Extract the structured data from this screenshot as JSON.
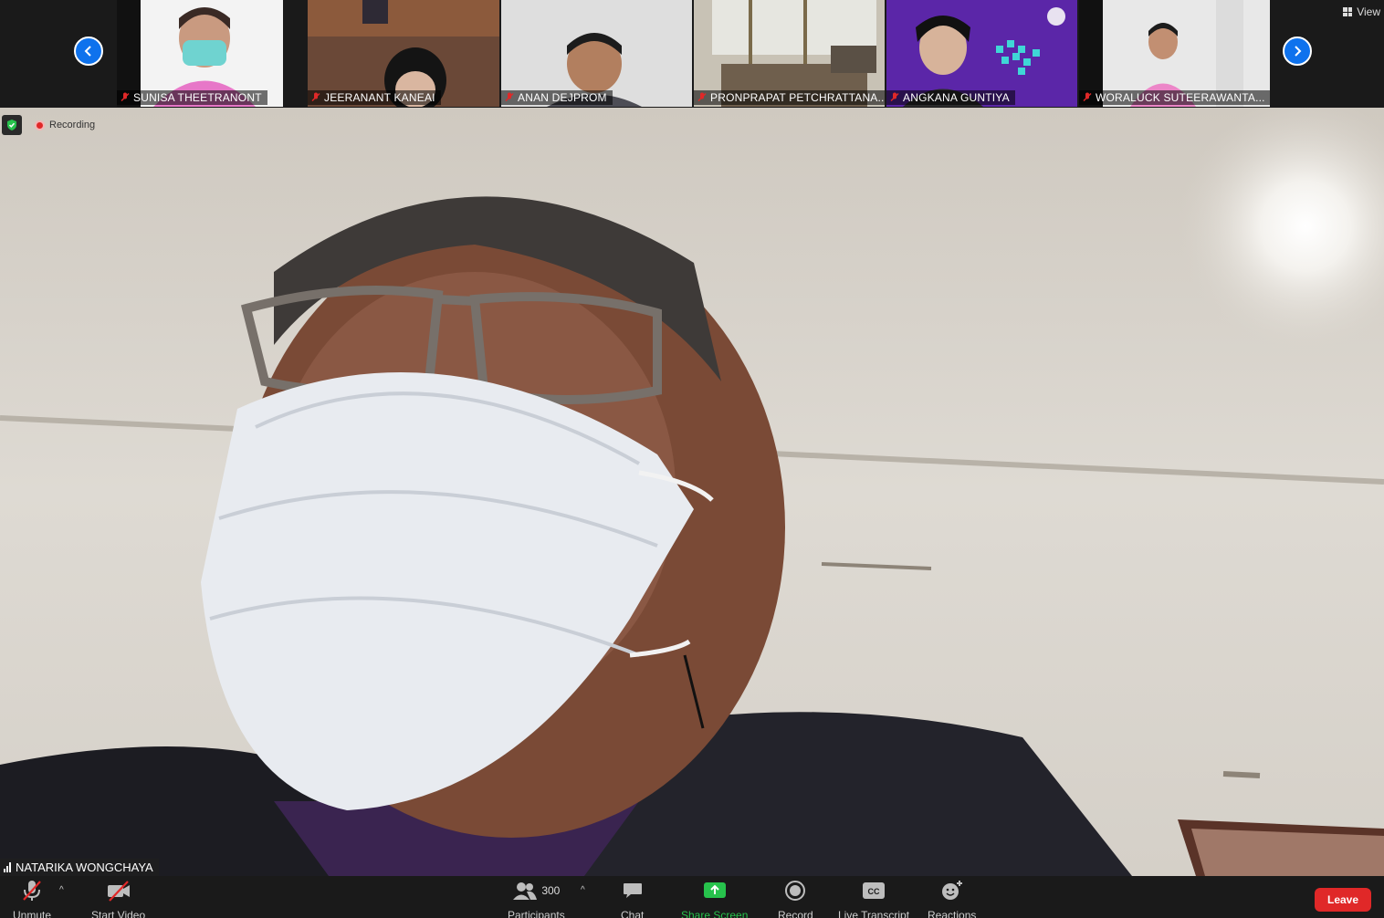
{
  "participants_strip": [
    {
      "name": "SUNISA THEETRANONT",
      "bg": "#f2f2f2"
    },
    {
      "name": "JEERANANT KANEAI",
      "bg": "#6b4a3a"
    },
    {
      "name": "ANAN DEJPROM",
      "bg": "#dcdcdc"
    },
    {
      "name": "PRONPRAPAT PETCHRATTANA...",
      "bg": "#b9b1a3"
    },
    {
      "name": "ANGKANA GUNTIYA",
      "bg": "#6a2fb4"
    },
    {
      "name": "WORALUCK SUTEERAWANTA...",
      "bg": "#e9e9e9"
    }
  ],
  "view_label": "View",
  "recording_label": "Recording",
  "active_speaker": "NATARIKA WONGCHAYA",
  "toolbar": {
    "unmute": "Unmute",
    "start_video": "Start Video",
    "participants": "Participants",
    "participant_count": "300",
    "chat": "Chat",
    "share_screen": "Share Screen",
    "record": "Record",
    "live_transcript": "Live Transcript",
    "cc": "CC",
    "reactions": "Reactions",
    "leave": "Leave"
  },
  "colors": {
    "accent_blue": "#0e72ed",
    "leave_red": "#e02828",
    "share_green": "#27c24c",
    "mute_red": "#e02828"
  }
}
